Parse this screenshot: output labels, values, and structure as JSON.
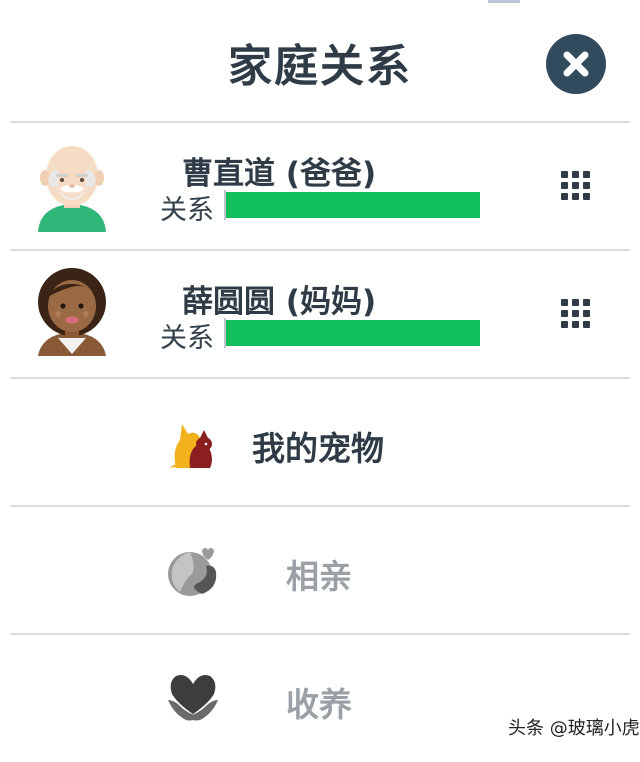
{
  "header": {
    "title": "家庭关系"
  },
  "members": [
    {
      "name": "曹直道 (爸爸)",
      "relation_label": "关系",
      "relation_level": 1.0
    },
    {
      "name": "薛圆圆 (妈妈)",
      "relation_label": "关系",
      "relation_level": 1.0
    }
  ],
  "menu": [
    {
      "label": "我的宠物",
      "icon": "dog-icon",
      "enabled": true
    },
    {
      "label": "相亲",
      "icon": "couple-heart-icon",
      "enabled": false
    },
    {
      "label": "收养",
      "icon": "hands-heart-icon",
      "enabled": false
    }
  ],
  "watermark": "头条 @玻璃小虎",
  "colors": {
    "title": "#2f3b46",
    "close_button": "#324a5e",
    "relation_bar": "#11c05b",
    "disabled_text": "#9aa0a5",
    "divider": "#d9dde1"
  }
}
